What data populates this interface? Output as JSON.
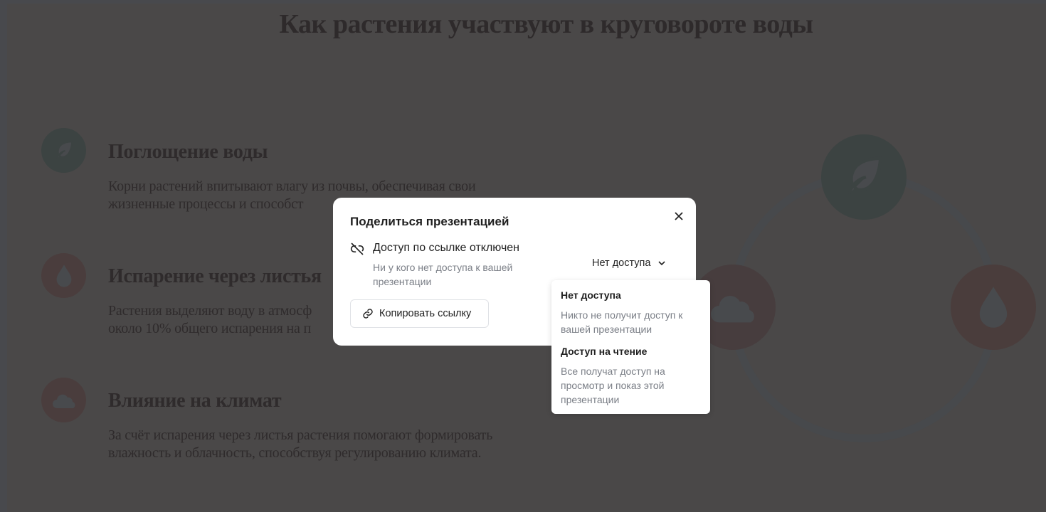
{
  "slide": {
    "title": "Как растения участвуют в круговороте воды",
    "items": [
      {
        "icon": "leaf-icon",
        "heading": "Поглощение воды",
        "lines": [
          "Корни растений впитывают влагу из почвы, обеспечивая свои",
          "жизненные процессы и способст"
        ]
      },
      {
        "icon": "water-drop-icon",
        "heading": "Испарение через листья",
        "lines": [
          "Растения выделяют воду в атмосф",
          "около 10% общего испарения на п"
        ]
      },
      {
        "icon": "cloud-icon",
        "heading": "Влияние на климат",
        "lines": [
          "За счёт испарения через листья растения помогают формировать",
          "влажность и облачность, способствуя регулированию климата."
        ]
      }
    ],
    "colors": {
      "green": "#3c4342",
      "red": "#4a3d3d",
      "glyph": "#484a4d"
    }
  },
  "share_dialog": {
    "title": "Поделиться презентацией",
    "status": "Доступ по ссылке отключен",
    "status_description": "Ни у кого нет доступа к вашей презентации",
    "access_select": "Нет доступа",
    "copy_link": "Копировать ссылку",
    "options": [
      {
        "title": "Нет доступа",
        "description": "Никто не получит доступ к вашей презентации"
      },
      {
        "title": "Доступ на чтение",
        "description": "Все получат доступ на просмотр и показ этой презентации"
      }
    ]
  }
}
